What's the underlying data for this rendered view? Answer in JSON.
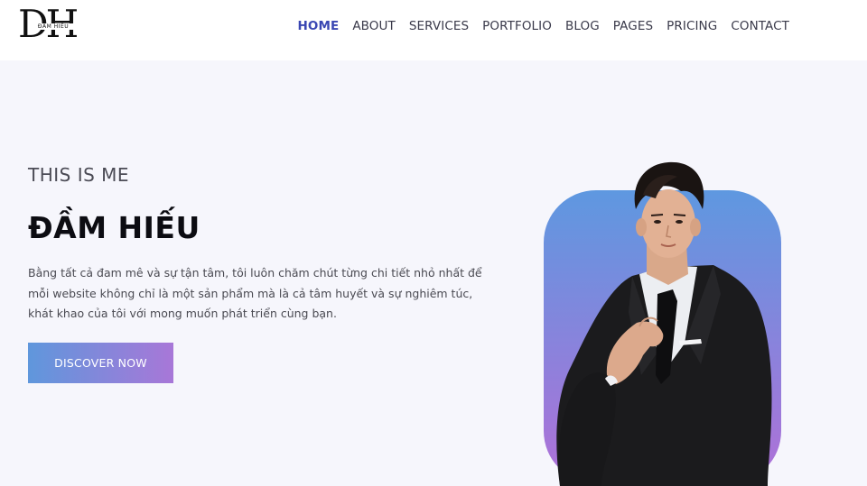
{
  "header": {
    "logo": {
      "letters": "DH",
      "subtitle": "ĐẦM HIẾU"
    },
    "nav": [
      {
        "label": "HOME",
        "active": true
      },
      {
        "label": "ABOUT",
        "active": false
      },
      {
        "label": "SERVICES",
        "active": false
      },
      {
        "label": "PORTFOLIO",
        "active": false
      },
      {
        "label": "BLOG",
        "active": false
      },
      {
        "label": "PAGES",
        "active": false
      },
      {
        "label": "PRICING",
        "active": false
      },
      {
        "label": "CONTACT",
        "active": false
      }
    ]
  },
  "hero": {
    "eyebrow": "THIS IS ME",
    "name": "ĐẦM HIẾU",
    "description": "Bằng tất cả đam mê và sự tận tâm, tôi luôn chăm chút từng chi tiết nhỏ nhất để mỗi website không chỉ là một sản phẩm mà là cả tâm huyết và sự nghiêm túc, khát khao của tôi với mong muốn phát triển cùng bạn.",
    "cta_label": "DISCOVER NOW",
    "photo": "portrait-photo"
  },
  "colors": {
    "accent": "#3a47b3",
    "background": "#f6f6fc",
    "gradient_start": "#5f97dc",
    "gradient_end": "#a877d8"
  }
}
